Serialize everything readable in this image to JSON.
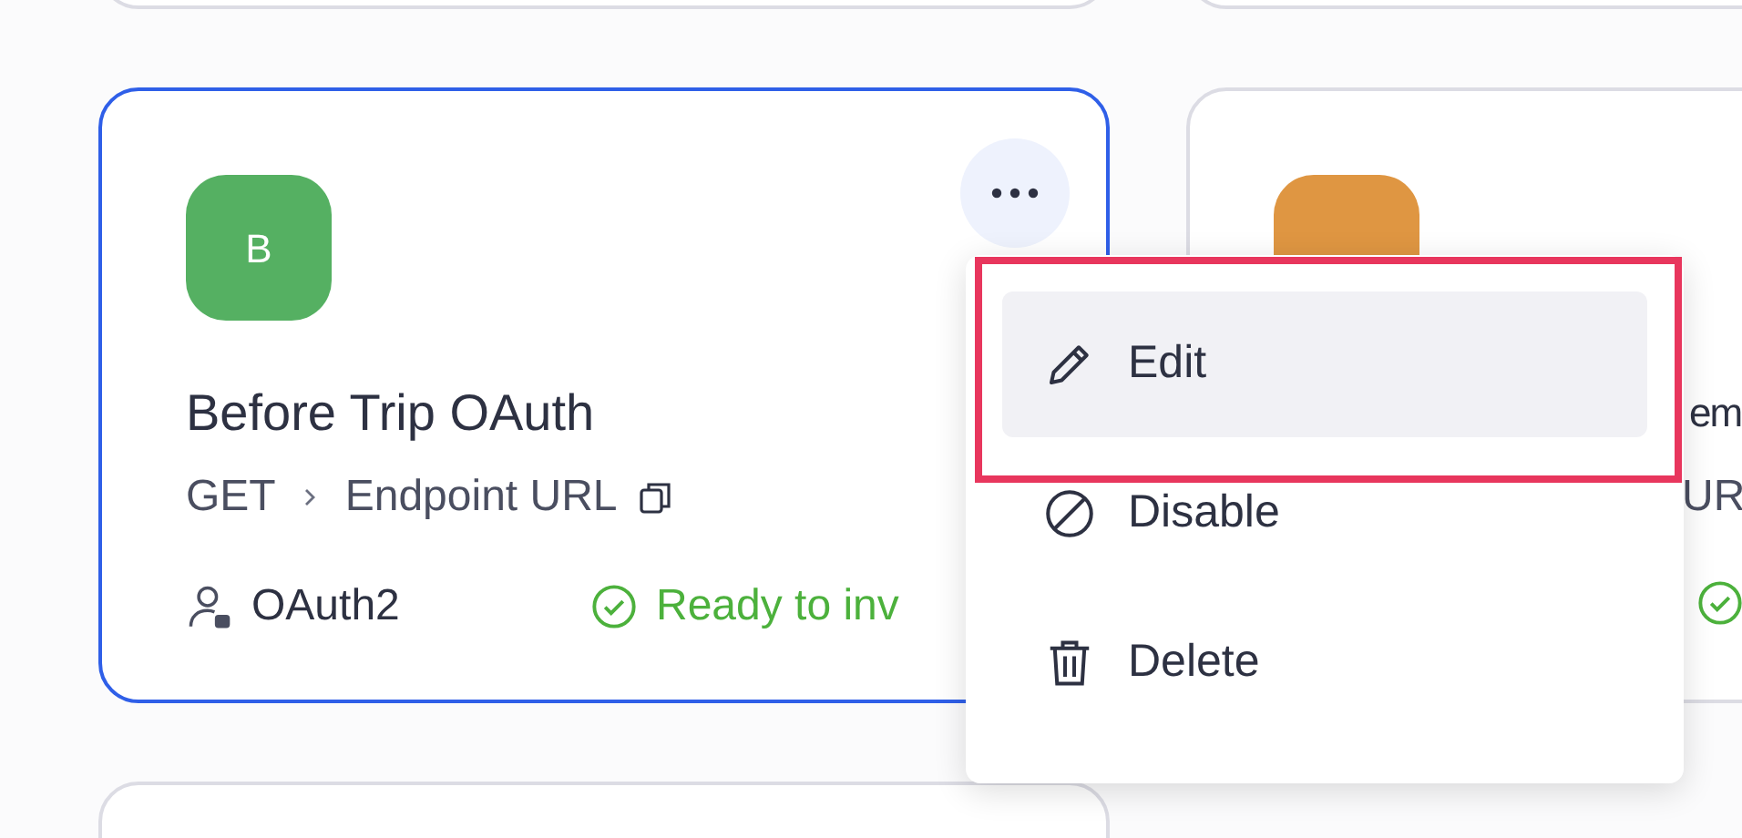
{
  "cards": [
    {
      "kind": "full",
      "selected": true,
      "avatar": {
        "letter": "B",
        "color": "#55b062"
      },
      "title": "Before Trip OAuth",
      "method": "GET",
      "endpoint": "Endpoint URL",
      "auth": "OAuth2",
      "status": "Ready to inv"
    },
    {
      "kind": "cut",
      "selected": false,
      "avatar": {
        "color": "#df9642"
      },
      "title": "em",
      "endpoint": "UR"
    }
  ],
  "menu": {
    "items": [
      {
        "kind": "edit",
        "label": "Edit",
        "hovered": true,
        "highlighted": true
      },
      {
        "kind": "disable",
        "label": "Disable",
        "hovered": false,
        "highlighted": false
      },
      {
        "kind": "delete",
        "label": "Delete",
        "hovered": false,
        "highlighted": false
      }
    ]
  }
}
